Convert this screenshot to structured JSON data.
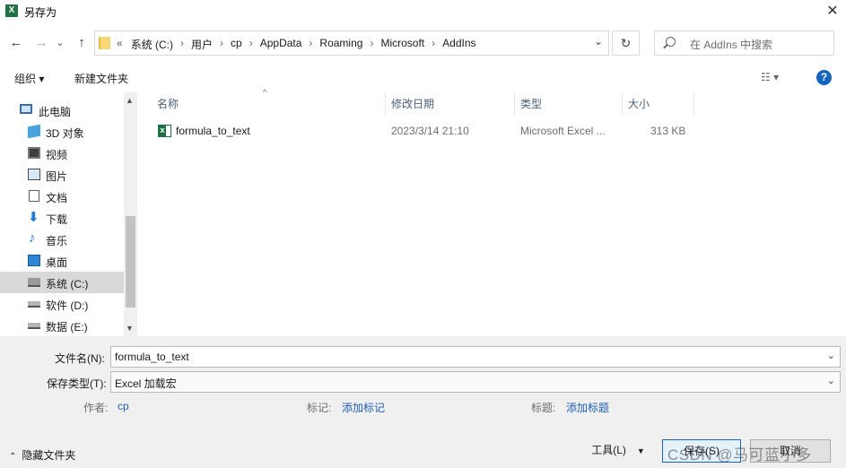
{
  "window": {
    "title": "另存为",
    "close_glyph": "✕"
  },
  "nav": {
    "back": "←",
    "forward": "→",
    "recent": "⌄",
    "up": "↑"
  },
  "address": {
    "prefix": "«",
    "crumbs": [
      "系统 (C:)",
      "用户",
      "cp",
      "AppData",
      "Roaming",
      "Microsoft",
      "AddIns"
    ],
    "separator": "›",
    "dropdown": "⌄",
    "refresh": "↻"
  },
  "search": {
    "placeholder": "在 AddIns 中搜索"
  },
  "toolbar": {
    "organize": "组织 ▾",
    "new_folder": "新建文件夹",
    "view": "☷ ▾",
    "help": "?"
  },
  "sidebar": {
    "items": [
      {
        "label": "此电脑",
        "icon": "computer-icon"
      },
      {
        "label": "3D 对象",
        "icon": "cube-icon"
      },
      {
        "label": "视频",
        "icon": "video-icon"
      },
      {
        "label": "图片",
        "icon": "picture-icon"
      },
      {
        "label": "文档",
        "icon": "document-icon"
      },
      {
        "label": "下载",
        "icon": "download-icon"
      },
      {
        "label": "音乐",
        "icon": "music-icon"
      },
      {
        "label": "桌面",
        "icon": "desktop-icon"
      },
      {
        "label": "系统 (C:)",
        "icon": "drive-system-icon",
        "selected": true
      },
      {
        "label": "软件 (D:)",
        "icon": "drive-icon"
      },
      {
        "label": "数据 (E:)",
        "icon": "drive-icon"
      }
    ]
  },
  "columns": {
    "name": "名称",
    "modified": "修改日期",
    "type": "类型",
    "size": "大小",
    "sort_indicator": "^"
  },
  "files": [
    {
      "name": "formula_to_text",
      "modified": "2023/3/14 21:10",
      "type": "Microsoft Excel ...",
      "size": "313 KB",
      "icon": "excel-addin-icon"
    }
  ],
  "form": {
    "filename_label": "文件名(N):",
    "filename_value": "formula_to_text",
    "filetype_label": "保存类型(T):",
    "filetype_value": "Excel 加载宏",
    "author_label": "作者:",
    "author_value": "cp",
    "tags_label": "标记:",
    "tags_value": "添加标记",
    "title_label": "标题:",
    "title_value": "添加标题"
  },
  "footer": {
    "hide_folders": "隐藏文件夹",
    "tools": "工具(L)",
    "save": "保存(S)",
    "cancel": "取消",
    "watermark": "CSDN @马可蓝小多"
  },
  "colors": {
    "accent": "#1565c0",
    "excel": "#1e7145",
    "link": "#1c5fb5"
  }
}
